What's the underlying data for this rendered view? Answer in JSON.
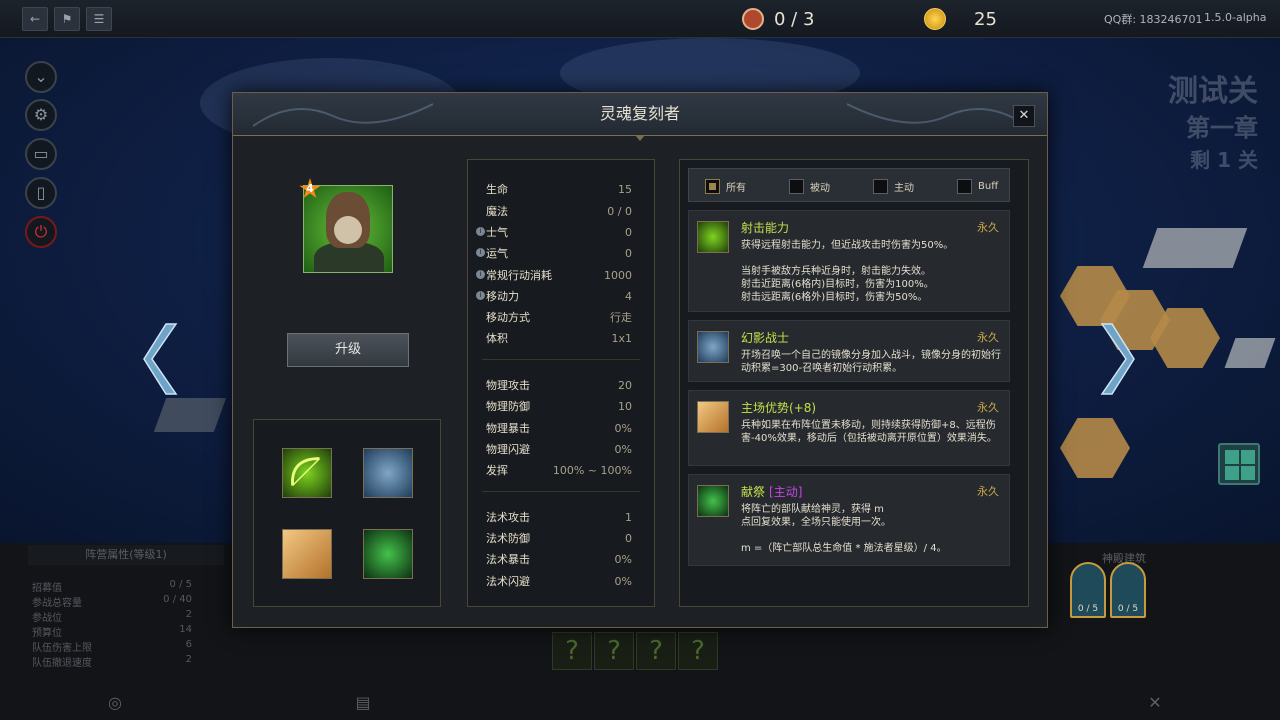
{
  "topbar": {
    "back_icon": "←",
    "flag_icon": "⚑",
    "menu_icon": "☰",
    "meat_count": "0 / 3",
    "gold_count": "25",
    "qq_group": "QQ群: 183246701",
    "version": "1.5.0-alpha"
  },
  "level": {
    "line1": "测试关",
    "line2": "第一章",
    "line3": "剩 1 关"
  },
  "modal": {
    "title": "灵魂复刻者",
    "close_label": "✕",
    "unit_level": "4",
    "upgrade_label": "升级"
  },
  "stats": {
    "group1": [
      {
        "label": "生命",
        "value": "15",
        "info": false
      },
      {
        "label": "魔法",
        "value": "0 / 0",
        "info": false
      },
      {
        "label": "士气",
        "value": "0",
        "info": true
      },
      {
        "label": "运气",
        "value": "0",
        "info": true
      },
      {
        "label": "常规行动消耗",
        "value": "1000",
        "info": true
      },
      {
        "label": "移动力",
        "value": "4",
        "info": true
      },
      {
        "label": "移动方式",
        "value": "行走",
        "info": false
      },
      {
        "label": "体积",
        "value": "1x1",
        "info": false
      }
    ],
    "group2": [
      {
        "label": "物理攻击",
        "value": "20"
      },
      {
        "label": "物理防御",
        "value": "10"
      },
      {
        "label": "物理暴击",
        "value": "0%"
      },
      {
        "label": "物理闪避",
        "value": "0%"
      },
      {
        "label": "发挥",
        "value": "100% ~ 100%"
      }
    ],
    "group3": [
      {
        "label": "法术攻击",
        "value": "1"
      },
      {
        "label": "法术防御",
        "value": "0"
      },
      {
        "label": "法术暴击",
        "value": "0%"
      },
      {
        "label": "法术闪避",
        "value": "0%"
      }
    ]
  },
  "filters": [
    {
      "label": "所有",
      "checked": true
    },
    {
      "label": "被动",
      "checked": false
    },
    {
      "label": "主动",
      "checked": false
    },
    {
      "label": "Buff",
      "checked": false
    }
  ],
  "abilities": [
    {
      "name": "射击能力",
      "tag": "",
      "duration": "永久",
      "icon": "bow-icon",
      "desc": "获得远程射击能力，但近战攻击时伤害为50%。\n\n当射手被敌方兵种近身时，射击能力失效。\n射击近距离(6格内)目标时，伤害为100%。\n射击远距离(6格外)目标时，伤害为50%。"
    },
    {
      "name": "幻影战士",
      "tag": "",
      "duration": "永久",
      "icon": "ghost-warrior-icon",
      "desc": "开场召唤一个自己的镜像分身加入战斗，镜像分身的初始行动积累=300-召唤者初始行动积累。"
    },
    {
      "name": "主场优势(+8)",
      "tag": "",
      "duration": "永久",
      "icon": "map-icon",
      "desc": "兵种如果在布阵位置未移动，则持续获得防御+8、远程伤害-40%效果，移动后（包括被动离开原位置）效果消失。"
    },
    {
      "name": "献祭",
      "tag": "[主动]",
      "duration": "永久",
      "icon": "sacrifice-icon",
      "desc": "将阵亡的部队献给神灵，获得 m\n点回复效果，全场只能使用一次。\n\nm =（阵亡部队总生命值 * 施法者星级）/ 4。"
    }
  ],
  "bottom": {
    "left_header": "阵营属性(等级1)",
    "left_rows": [
      {
        "label": "招募值",
        "value": "0 / 5"
      },
      {
        "label": "参战总容量",
        "value": "0 / 40"
      },
      {
        "label": "参战位",
        "value": "2"
      },
      {
        "label": "预算位",
        "value": "14"
      },
      {
        "label": "队伍伤害上限",
        "value": "6"
      },
      {
        "label": "队伍撤退速度",
        "value": "2"
      }
    ],
    "question_mark": "?",
    "right_header": "神殿建筑",
    "arch1": "0 / 5",
    "arch2": "0 / 5"
  },
  "colors": {
    "ability_name": "#c5e04a",
    "duration": "#c8a64a",
    "active_tag": "#c844e6",
    "accent_gold": "#8f7a4a"
  }
}
